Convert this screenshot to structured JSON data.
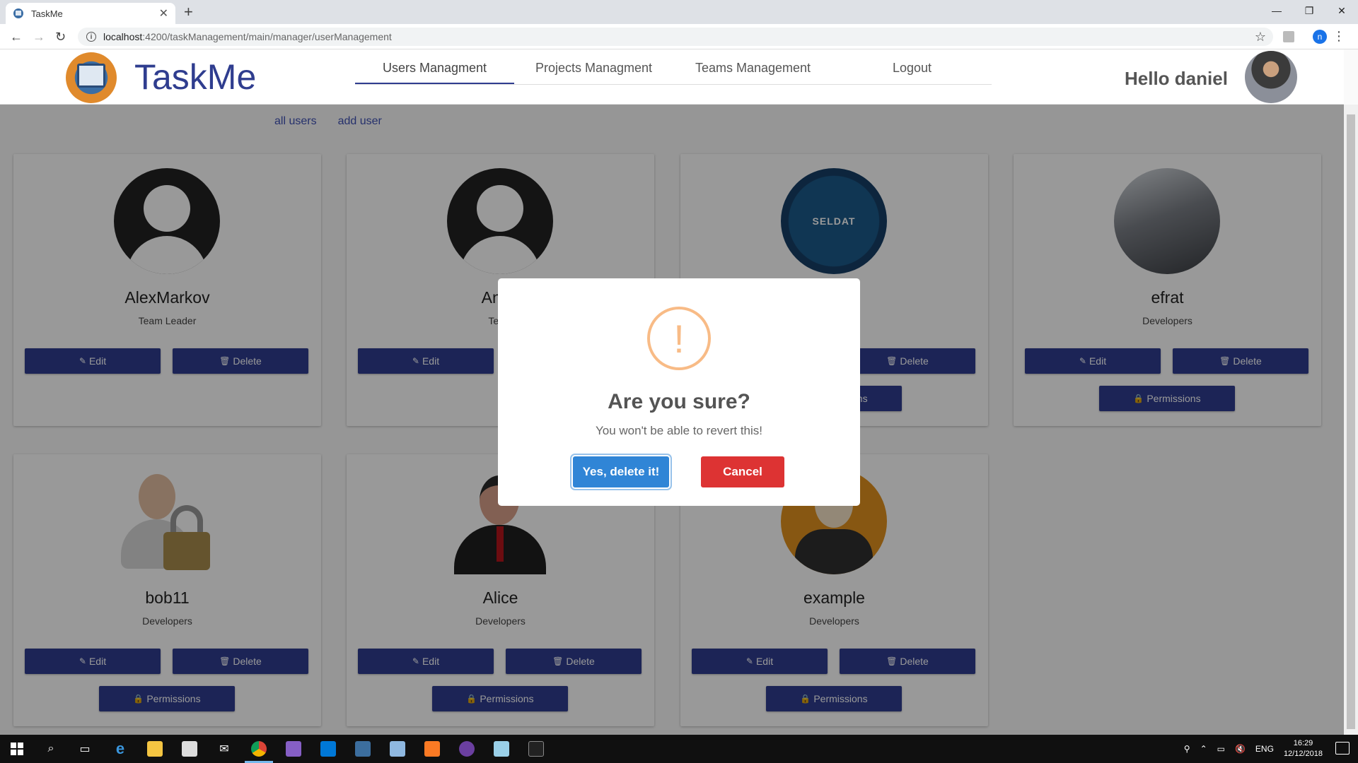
{
  "browser": {
    "tab_title": "TaskMe",
    "url_host": "localhost",
    "url_path": ":4200/taskManagement/main/manager/userManagement",
    "profile_initial": "n"
  },
  "app": {
    "logo_text": "TaskMe",
    "nav": [
      {
        "label": "Users Managment",
        "active": true
      },
      {
        "label": "Projects Managment",
        "active": false
      },
      {
        "label": "Teams Management",
        "active": false
      },
      {
        "label": "Logout",
        "active": false
      }
    ],
    "greeting": "Hello daniel"
  },
  "subnav": {
    "all_users": "all users",
    "add_user": "add user"
  },
  "buttons": {
    "edit": "Edit",
    "delete": "Delete",
    "permissions": "Permissions"
  },
  "users": [
    {
      "name": "AlexMarkov",
      "role": "Team Leader",
      "avatar": "default-avatar"
    },
    {
      "name": "Anna",
      "role": "Team",
      "avatar": "default-avatar"
    },
    {
      "name": "",
      "role": "",
      "avatar": "seldat-logo",
      "avatar_text": "SELDAT"
    },
    {
      "name": "efrat",
      "role": "Developers",
      "avatar": "photo"
    },
    {
      "name": "bob11",
      "role": "Developers",
      "avatar": "lock-user"
    },
    {
      "name": "Alice",
      "role": "Developers",
      "avatar": "businessman"
    },
    {
      "name": "example",
      "role": "Developers",
      "avatar": "orange-avatar"
    }
  ],
  "dialog": {
    "icon": "!",
    "title": "Are you sure?",
    "text": "You won't be able to revert this!",
    "confirm": "Yes, delete it!",
    "cancel": "Cancel",
    "colors": {
      "confirm": "#3085d6",
      "cancel": "#dd3333",
      "icon": "#f8bb86"
    }
  },
  "taskbar": {
    "lang": "ENG",
    "time": "16:29",
    "date": "12/12/2018"
  },
  "colors": {
    "primary": "#2f3d8f",
    "link": "#3f51b5"
  }
}
